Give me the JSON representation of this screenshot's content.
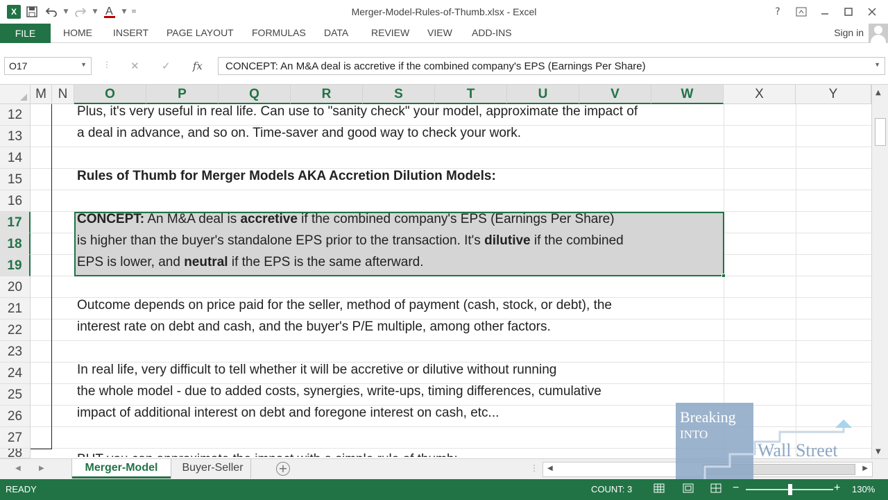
{
  "window": {
    "title": "Merger-Model-Rules-of-Thumb.xlsx - Excel",
    "help": "?"
  },
  "ribbon": {
    "file": "FILE",
    "tabs": [
      "HOME",
      "INSERT",
      "PAGE LAYOUT",
      "FORMULAS",
      "DATA",
      "REVIEW",
      "VIEW",
      "ADD-INS"
    ],
    "sign_in": "Sign in"
  },
  "formula_bar": {
    "name_box": "O17",
    "fx": "fx",
    "content": "CONCEPT: An M&A deal is accretive if the combined company's EPS (Earnings Per Share)"
  },
  "columns": [
    "M",
    "N",
    "O",
    "P",
    "Q",
    "R",
    "S",
    "T",
    "U",
    "V",
    "W",
    "X",
    "Y"
  ],
  "rows": [
    "12",
    "13",
    "14",
    "15",
    "16",
    "17",
    "18",
    "19",
    "20",
    "21",
    "22",
    "23",
    "24",
    "25",
    "26",
    "27",
    "28"
  ],
  "cells": {
    "r12": "Plus, it's very useful in real life. Can use to \"sanity check\" your model, approximate the impact of",
    "r13": "a deal in advance, and so on. Time-saver and good way to check your work.",
    "r15": "Rules of Thumb for Merger Models AKA Accretion Dilution Models:",
    "r17": {
      "a": "CONCEPT:",
      "b": " An M&A deal is ",
      "c": "accretive",
      "d": " if the combined company's EPS (Earnings Per Share)"
    },
    "r18": {
      "a": "is higher than the buyer's standalone EPS prior to the transaction. It's ",
      "b": "dilutive",
      "c": " if the combined"
    },
    "r19": {
      "a": "EPS is lower, and ",
      "b": "neutral",
      "c": " if the EPS is the same afterward."
    },
    "r21": "Outcome depends on price paid for the seller, method of payment (cash, stock, or debt), the",
    "r22": "interest rate on debt and cash, and the buyer's P/E multiple, among other factors.",
    "r24": "In real life, very difficult to tell whether it will be accretive or dilutive without running",
    "r25": "the whole model - due to added costs, synergies, write-ups, timing differences, cumulative",
    "r26": "impact of additional interest on debt and foregone interest on cash, etc...",
    "r28": " BUT you can approximate the impact with a simple rule of thumb:"
  },
  "sheets": {
    "active": "Merger-Model",
    "other": "Buyer-Seller",
    "add": "+"
  },
  "status": {
    "ready": "READY",
    "count": "COUNT: 3",
    "zoom": "130%",
    "zoom_minus": "−",
    "zoom_plus": "+"
  },
  "watermark": {
    "line1": "Breaking",
    "line2": "INTO",
    "line3": "Wall Street"
  },
  "colors": {
    "excel_green": "#217346",
    "selection_fill": "#d5d5d5",
    "logo_blue": "#8ba6c4"
  }
}
